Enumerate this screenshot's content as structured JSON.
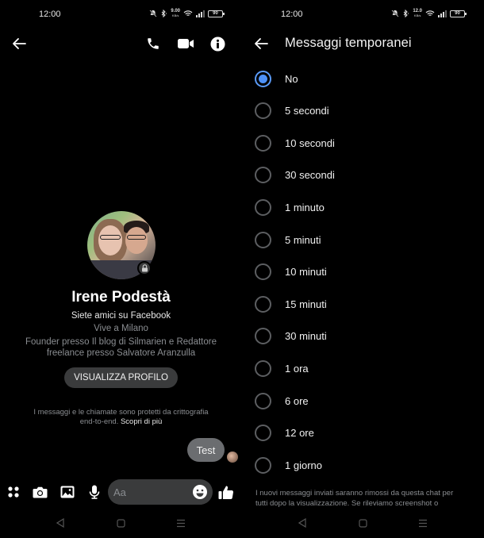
{
  "status_bar": {
    "left": {
      "time": "12:00",
      "net_speed": "9.00",
      "net_unit": "KB/s",
      "battery": "90"
    },
    "right": {
      "time": "12:00",
      "net_speed": "12.0",
      "net_unit": "KB/s",
      "battery": "90"
    },
    "icons": [
      "mute-icon",
      "bluetooth-icon",
      "wifi-icon",
      "signal-icon",
      "battery-icon"
    ]
  },
  "chat": {
    "top_icons": [
      "back-arrow-icon",
      "phone-icon",
      "video-camera-icon",
      "info-icon"
    ],
    "profile": {
      "name": "Irene Podestà",
      "relation": "Siete amici su Facebook",
      "lives": "Vive a Milano",
      "work_line1": "Founder presso Il blog di Silmarien e Redattore",
      "work_line2": "freelance presso Salvatore Aranzulla",
      "view_profile_label": "VISUALIZZA PROFILO"
    },
    "encryption": {
      "line1": "I messaggi e le chiamate sono protetti da crittografia",
      "line2": "end-to-end.",
      "link": "Scopri di più"
    },
    "messages": [
      {
        "text": "Test",
        "sender": "me"
      }
    ],
    "composer": {
      "placeholder": "Aa",
      "icons": [
        "menu-dots-icon",
        "camera-icon",
        "gallery-icon",
        "microphone-icon",
        "emoji-icon",
        "thumbs-up-icon"
      ]
    }
  },
  "settings": {
    "title": "Messaggi temporanei",
    "selected": "No",
    "options": [
      {
        "label": "No",
        "checked": true
      },
      {
        "label": "5 secondi",
        "checked": false
      },
      {
        "label": "10 secondi",
        "checked": false
      },
      {
        "label": "30 secondi",
        "checked": false
      },
      {
        "label": "1 minuto",
        "checked": false
      },
      {
        "label": "5 minuti",
        "checked": false
      },
      {
        "label": "10 minuti",
        "checked": false
      },
      {
        "label": "15 minuti",
        "checked": false
      },
      {
        "label": "30 minuti",
        "checked": false
      },
      {
        "label": "1 ora",
        "checked": false
      },
      {
        "label": "6 ore",
        "checked": false
      },
      {
        "label": "12 ore",
        "checked": false
      },
      {
        "label": "1 giorno",
        "checked": false
      }
    ],
    "note_line1": "I nuovi messaggi inviati saranno rimossi da questa chat per",
    "note_line2": "tutti dopo la visualizzazione. Se rileviamo screenshot o"
  },
  "nav_bar": {
    "icons": [
      "back-triangle-icon",
      "home-square-icon",
      "recents-menu-icon"
    ]
  }
}
